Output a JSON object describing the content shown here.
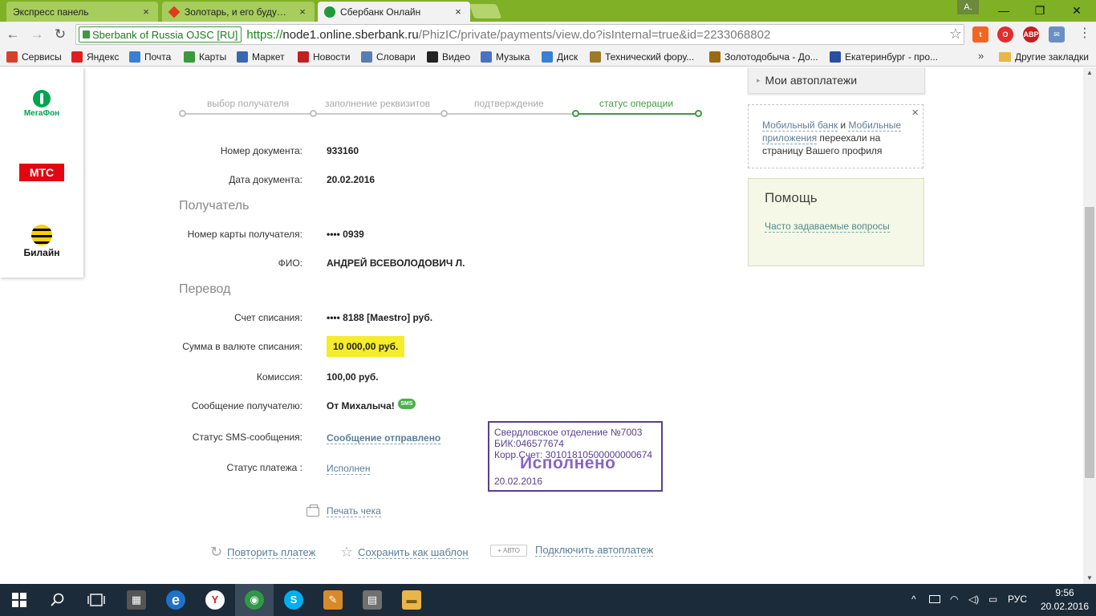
{
  "browser": {
    "tabs": [
      {
        "title": "Экспресс панель",
        "close": "×",
        "active": false
      },
      {
        "title": "Золотарь, и его будущее",
        "close": "×",
        "active": false
      },
      {
        "title": "Сбербанк Онлайн",
        "close": "×",
        "active": true
      }
    ],
    "profile_badge": "A.",
    "window_controls": {
      "minimize": "—",
      "maximize": "❐",
      "close": "✕"
    },
    "nav": {
      "back": "←",
      "forward": "→",
      "reload": "↻"
    },
    "ev_badge": "Sberbank of Russia OJSC [RU]",
    "url": {
      "scheme": "https://",
      "host": "node1.online.sberbank.ru",
      "path": "/PhizIC/private/payments/view.do?isInternal=true&id=2233068802"
    },
    "star": "☆",
    "extensions": [
      {
        "name": "tumblr",
        "label": "t",
        "color": "#f26522"
      },
      {
        "name": "opera",
        "label": "O",
        "color": "#e52b2b"
      },
      {
        "name": "adblock",
        "label": "ABP",
        "color": "#c91c1c"
      },
      {
        "name": "mail",
        "label": "✉",
        "color": "#6a8fc7"
      }
    ],
    "menu": "⋮",
    "bookmarks": [
      {
        "label": "Сервисы",
        "color": "#d9402b"
      },
      {
        "label": "Яндекс",
        "color": "#e02020"
      },
      {
        "label": "Почта",
        "color": "#3a7fd1"
      },
      {
        "label": "Карты",
        "color": "#3a9b3a"
      },
      {
        "label": "Маркет",
        "color": "#3a68b0"
      },
      {
        "label": "Новости",
        "color": "#c02020"
      },
      {
        "label": "Словари",
        "color": "#5a7db0"
      },
      {
        "label": "Видео",
        "color": "#222222"
      },
      {
        "label": "Музыка",
        "color": "#4a72c4"
      },
      {
        "label": "Диск",
        "color": "#3a7fd1"
      },
      {
        "label": "Технический фору...",
        "color": "#9b7a2a"
      },
      {
        "label": "Золотодобыча - До...",
        "color": "#9b6a10"
      },
      {
        "label": "Екатеринбург - про...",
        "color": "#2a4ea0"
      }
    ],
    "bookmarks_more": "»",
    "other_bookmarks": "Другие закладки"
  },
  "operators": [
    {
      "name": "МегаФон"
    },
    {
      "name": "МТС"
    },
    {
      "name": "Билайн"
    }
  ],
  "steps": [
    {
      "label": "выбор получателя",
      "done": false
    },
    {
      "label": "заполнение реквизитов",
      "done": false
    },
    {
      "label": "подтверждение",
      "done": false
    },
    {
      "label": "статус операции",
      "done": true
    }
  ],
  "document": {
    "number_label": "Номер документа:",
    "number": "933160",
    "date_label": "Дата документа:",
    "date": "20.02.2016"
  },
  "recipient": {
    "title": "Получатель",
    "card_label": "Номер карты получателя:",
    "card": "•••• 0939",
    "name_label": "ФИО:",
    "name": "АНДРЕЙ ВСЕВОЛОДОВИЧ Л."
  },
  "transfer": {
    "title": "Перевод",
    "account_label": "Счет списания:",
    "account": "•••• 8188  [Maestro]  руб.",
    "amount_label": "Сумма в валюте списания:",
    "amount": "10 000,00  руб.",
    "fee_label": "Комиссия:",
    "fee": "100,00 руб.",
    "message_label": "Сообщение получателю:",
    "message": "От Михалыча!",
    "sms_badge": "SMS",
    "sms_status_label": "Статус SMS-сообщения:",
    "sms_status": "Сообщение отправлено",
    "payment_status_label": "Статус платежа :",
    "payment_status": "Исполнен"
  },
  "stamp": {
    "line1": "Свердловское отделение №7003",
    "line2": "БИК:046577674",
    "line3": "Корр.Счет: 30101810500000000674",
    "big": "Исполнено",
    "date": "20.02.2016"
  },
  "actions": {
    "print": "Печать чека",
    "repeat": "Повторить платеж",
    "save_template": "Сохранить как шаблон",
    "auto_badge": "+ АВТО",
    "autopay": "Подключить автоплатеж"
  },
  "sidebar": {
    "autopay": "Мои автоплатежи",
    "notice": {
      "link1": "Мобильный банк",
      "and": " и ",
      "link2": "Мобильные приложения",
      "rest": " переехали на страницу Вашего профиля",
      "close": "×"
    },
    "help": {
      "title": "Помощь",
      "faq": "Часто задаваемые вопросы"
    }
  },
  "taskbar": {
    "apps": [
      {
        "name": "start"
      },
      {
        "name": "search"
      },
      {
        "name": "task-view"
      },
      {
        "name": "calculator",
        "label": "▦",
        "color": "#555"
      },
      {
        "name": "edge",
        "label": "e",
        "color": "#1e72c8"
      },
      {
        "name": "yandex-browser",
        "label": "Y",
        "color": "#e02020"
      },
      {
        "name": "chrome",
        "label": "◉",
        "color": "#2f9a46"
      },
      {
        "name": "skype",
        "label": "S",
        "color": "#00aff0"
      },
      {
        "name": "paint",
        "label": "✎",
        "color": "#d88a2a"
      },
      {
        "name": "app",
        "label": "▤",
        "color": "#707070"
      },
      {
        "name": "explorer",
        "label": "▬",
        "color": "#e8b64a"
      }
    ],
    "tray_chevron": "^",
    "language": "РУС",
    "time": "9:56",
    "date": "20.02.2016"
  }
}
